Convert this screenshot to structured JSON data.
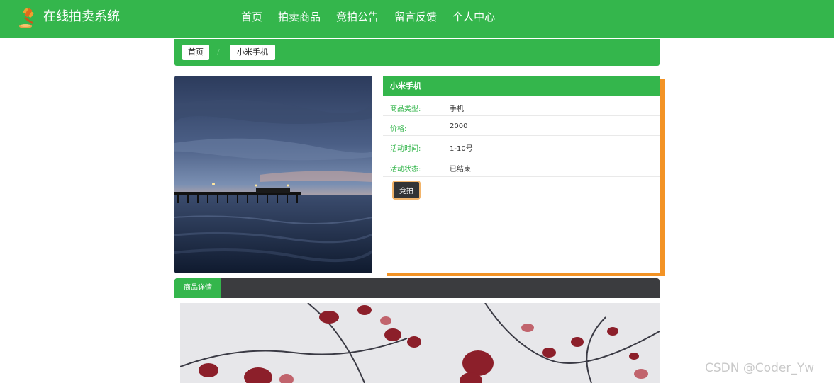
{
  "header": {
    "brand": "在线拍卖系统",
    "nav": [
      "首页",
      "拍卖商品",
      "竞拍公告",
      "留言反馈",
      "个人中心"
    ]
  },
  "breadcrumb": {
    "home": "首页",
    "current": "小米手机"
  },
  "product": {
    "title": "小米手机",
    "fields": [
      {
        "label": "商品类型:",
        "value": "手机"
      },
      {
        "label": "价格:",
        "value": "2000"
      },
      {
        "label": "活动时间:",
        "value": "1-10号"
      },
      {
        "label": "活动状态:",
        "value": "已结束"
      }
    ],
    "bid_button": "竞拍"
  },
  "detail_tab": "商品详情",
  "watermark": "CSDN @Coder_Yw",
  "colors": {
    "primary_green": "#34b64c",
    "accent_orange": "#f39325",
    "dark_bar": "#3b3c3f"
  }
}
